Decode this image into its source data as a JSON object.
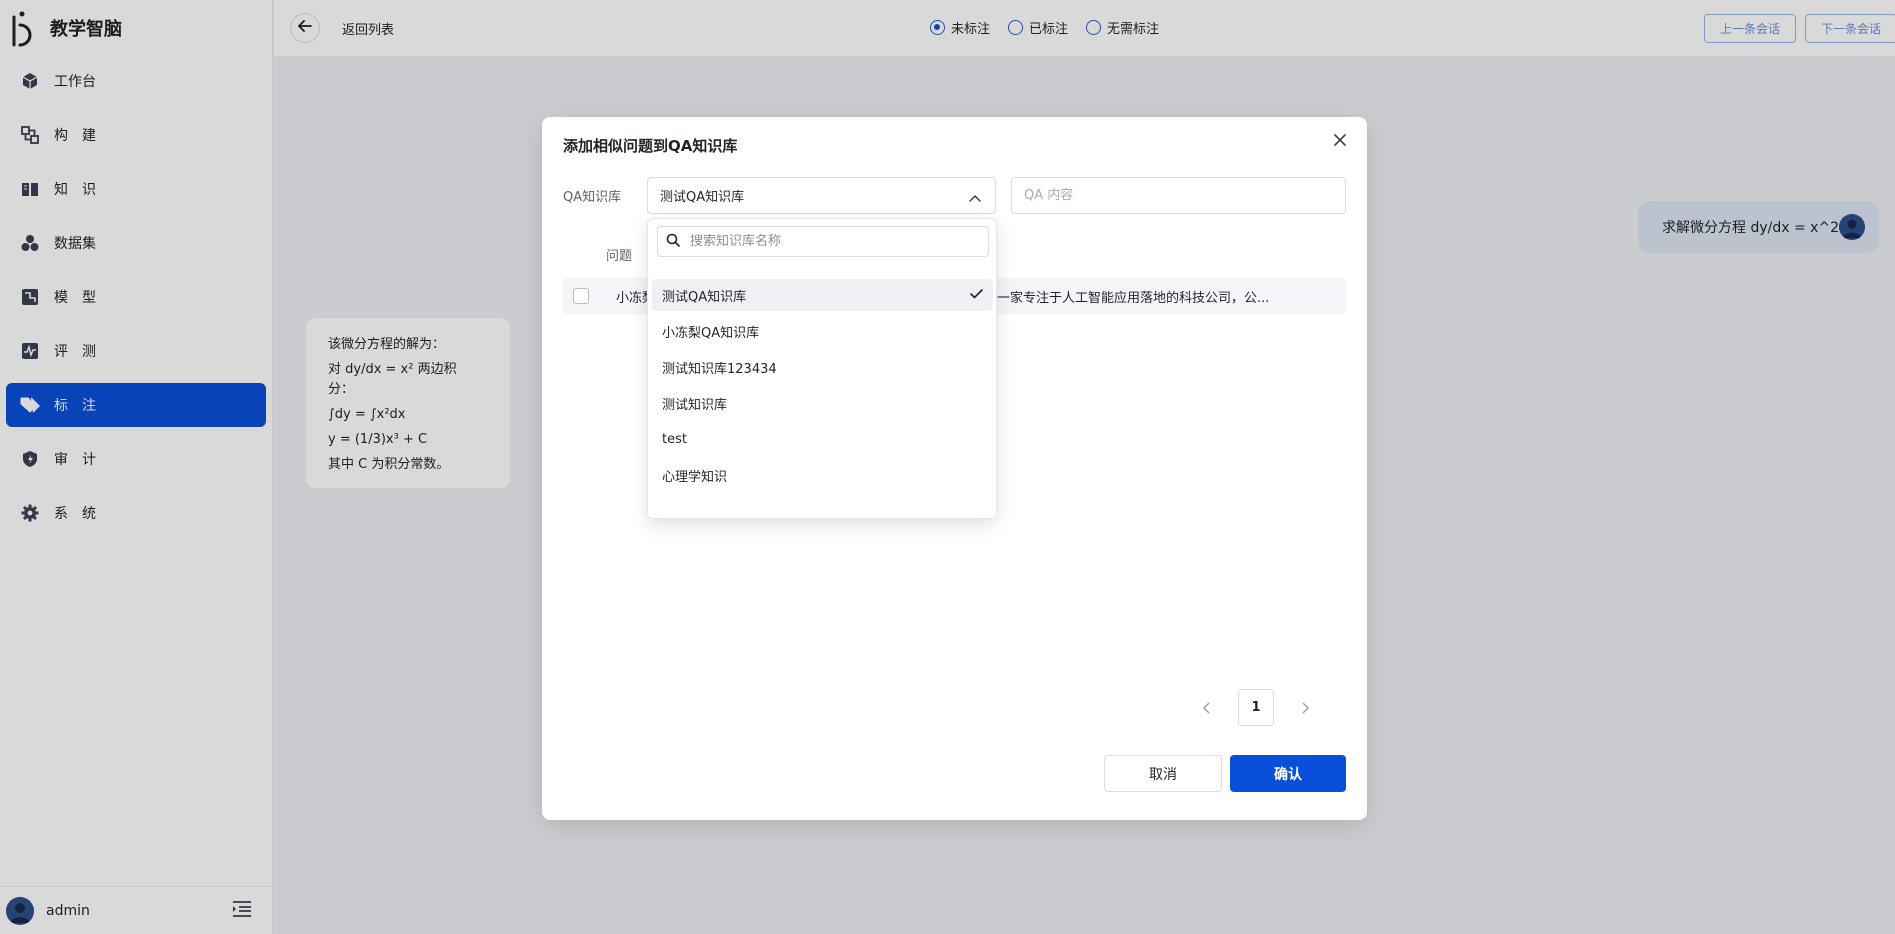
{
  "brand": {
    "title": "教学智脑"
  },
  "sidebar": {
    "items": [
      {
        "label": "工作台",
        "icon": "cube-icon",
        "active": false
      },
      {
        "label": "构　建",
        "icon": "build-icon",
        "active": false
      },
      {
        "label": "知　识",
        "icon": "book-icon",
        "active": false
      },
      {
        "label": "数据集",
        "icon": "dataset-icon",
        "active": false
      },
      {
        "label": "模　型",
        "icon": "model-icon",
        "active": false
      },
      {
        "label": "评　测",
        "icon": "pulse-icon",
        "active": false
      },
      {
        "label": "标　注",
        "icon": "tag-icon",
        "active": true
      },
      {
        "label": "审　计",
        "icon": "audit-shield-icon",
        "active": false
      },
      {
        "label": "系　统",
        "icon": "gear-icon",
        "active": false
      }
    ],
    "user": "admin"
  },
  "topbar": {
    "back_label": "返回列表",
    "radios": [
      {
        "label": "未标注",
        "checked": true
      },
      {
        "label": "已标注",
        "checked": false
      },
      {
        "label": "无需标注",
        "checked": false
      }
    ],
    "prev_label": "上一条会话",
    "next_label": "下一条会话"
  },
  "chat": {
    "user_message": "求解微分方程 dy/dx = x^2",
    "bot_lines": [
      "该微分方程的解为：",
      "对 dy/dx = x² 两边积",
      "分：",
      "∫dy = ∫x²dx",
      "y = (1/3)x³ + C",
      "其中 C 为积分常数。"
    ]
  },
  "modal": {
    "title": "添加相似问题到QA知识库",
    "kb_label": "QA知识库",
    "kb_selected": "测试QA知识库",
    "qa_placeholder": "QA 内容",
    "col_question": "问题",
    "row": {
      "question": "小冻梨",
      "answer": "一家专注于人工智能应用落地的科技公司，公..."
    },
    "page": "1",
    "cancel_label": "取消",
    "ok_label": "确认"
  },
  "dropdown": {
    "search_placeholder": "搜索知识库名称",
    "options": [
      {
        "label": "测试QA知识库",
        "selected": true
      },
      {
        "label": "小冻梨QA知识库",
        "selected": false
      },
      {
        "label": "测试知识库123434",
        "selected": false
      },
      {
        "label": "测试知识库",
        "selected": false
      },
      {
        "label": "test",
        "selected": false
      },
      {
        "label": "心理学知识",
        "selected": false
      }
    ]
  },
  "colors": {
    "primary": "#0a4fd9",
    "background": "#eef0f5",
    "bubble": "#dfe5f3"
  }
}
